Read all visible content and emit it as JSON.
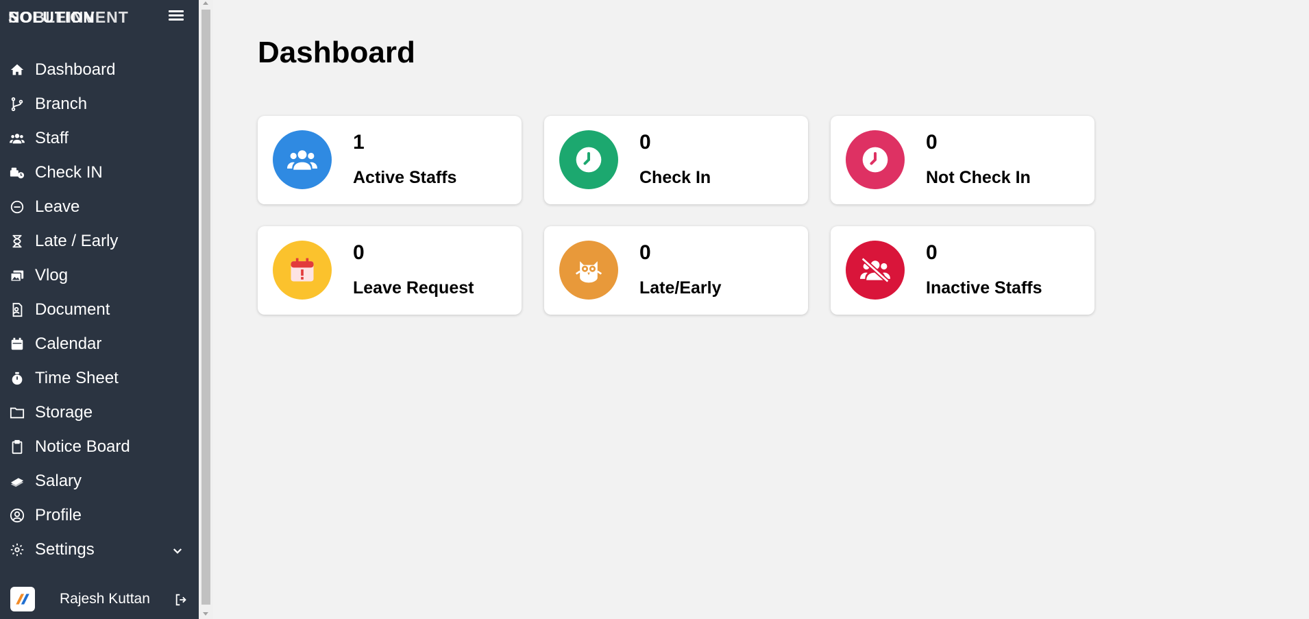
{
  "sidebar": {
    "brand_overlap": "NOBLEINVENT",
    "brand": "SOLUTION",
    "items": [
      {
        "label": "Dashboard"
      },
      {
        "label": "Branch"
      },
      {
        "label": "Staff"
      },
      {
        "label": "Check IN"
      },
      {
        "label": "Leave"
      },
      {
        "label": "Late / Early"
      },
      {
        "label": "Vlog"
      },
      {
        "label": "Document"
      },
      {
        "label": "Calendar"
      },
      {
        "label": "Time Sheet"
      },
      {
        "label": "Storage"
      },
      {
        "label": "Notice Board"
      },
      {
        "label": "Salary"
      },
      {
        "label": "Profile"
      },
      {
        "label": "Settings"
      }
    ],
    "user": {
      "name": "Rajesh Kuttan"
    }
  },
  "main": {
    "title": "Dashboard",
    "cards": [
      {
        "value": "1",
        "label": "Active Staffs",
        "color": "#2f8ae2",
        "icon": "users-icon"
      },
      {
        "value": "0",
        "label": "Check In",
        "color": "#1ca86f",
        "icon": "clock-icon"
      },
      {
        "value": "0",
        "label": "Not Check In",
        "color": "#de3163",
        "icon": "clock-icon"
      },
      {
        "value": "0",
        "label": "Leave Request",
        "color": "#fbc22d",
        "icon": "calendar-alert-icon"
      },
      {
        "value": "0",
        "label": "Late/Early",
        "color": "#e8993a",
        "icon": "owl-icon"
      },
      {
        "value": "0",
        "label": "Inactive Staffs",
        "color": "#d9153a",
        "icon": "users-slash-icon"
      }
    ]
  }
}
